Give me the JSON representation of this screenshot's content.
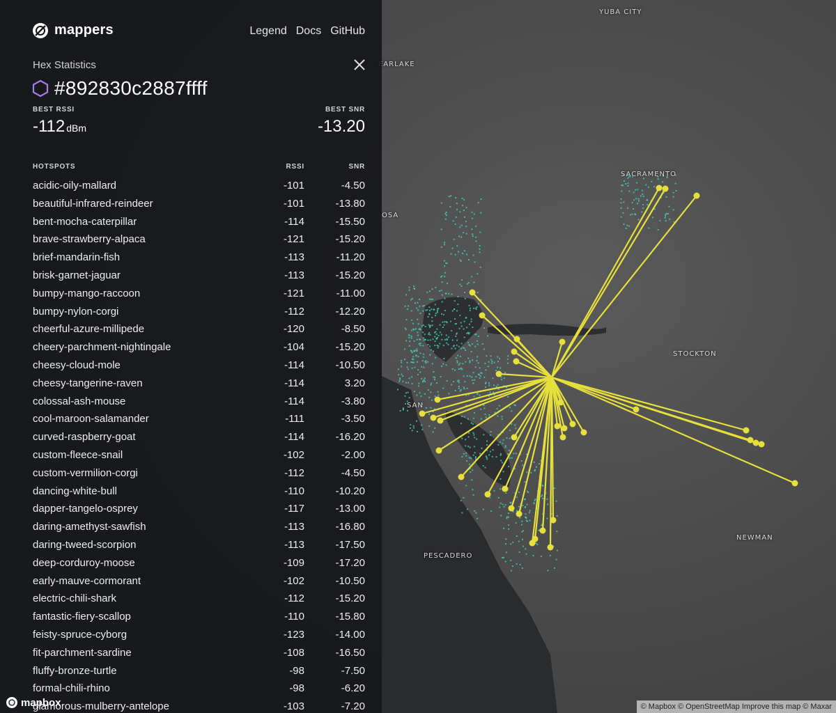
{
  "header": {
    "brand": "mappers",
    "nav": [
      "Legend",
      "Docs",
      "GitHub"
    ]
  },
  "panel": {
    "section_title": "Hex Statistics",
    "hex_id": "#892830c2887ffff",
    "best_rssi_label": "BEST RSSI",
    "best_rssi_value": "-112",
    "best_rssi_unit": "dBm",
    "best_snr_label": "BEST SNR",
    "best_snr_value": "-13.20",
    "table_headers": {
      "name": "HOTSPOTS",
      "rssi": "RSSI",
      "snr": "SNR"
    },
    "hotspots": [
      {
        "name": "acidic-oily-mallard",
        "rssi": "-101",
        "snr": "-4.50"
      },
      {
        "name": "beautiful-infrared-reindeer",
        "rssi": "-101",
        "snr": "-13.80"
      },
      {
        "name": "bent-mocha-caterpillar",
        "rssi": "-114",
        "snr": "-15.50"
      },
      {
        "name": "brave-strawberry-alpaca",
        "rssi": "-121",
        "snr": "-15.20"
      },
      {
        "name": "brief-mandarin-fish",
        "rssi": "-113",
        "snr": "-11.20"
      },
      {
        "name": "brisk-garnet-jaguar",
        "rssi": "-113",
        "snr": "-15.20"
      },
      {
        "name": "bumpy-mango-raccoon",
        "rssi": "-121",
        "snr": "-11.00"
      },
      {
        "name": "bumpy-nylon-corgi",
        "rssi": "-112",
        "snr": "-12.20"
      },
      {
        "name": "cheerful-azure-millipede",
        "rssi": "-120",
        "snr": "-8.50"
      },
      {
        "name": "cheery-parchment-nightingale",
        "rssi": "-104",
        "snr": "-15.20"
      },
      {
        "name": "cheesy-cloud-mole",
        "rssi": "-114",
        "snr": "-10.50"
      },
      {
        "name": "cheesy-tangerine-raven",
        "rssi": "-114",
        "snr": "3.20"
      },
      {
        "name": "colossal-ash-mouse",
        "rssi": "-114",
        "snr": "-3.80"
      },
      {
        "name": "cool-maroon-salamander",
        "rssi": "-111",
        "snr": "-3.50"
      },
      {
        "name": "curved-raspberry-goat",
        "rssi": "-114",
        "snr": "-16.20"
      },
      {
        "name": "custom-fleece-snail",
        "rssi": "-102",
        "snr": "-2.00"
      },
      {
        "name": "custom-vermilion-corgi",
        "rssi": "-112",
        "snr": "-4.50"
      },
      {
        "name": "dancing-white-bull",
        "rssi": "-110",
        "snr": "-10.20"
      },
      {
        "name": "dapper-tangelo-osprey",
        "rssi": "-117",
        "snr": "-13.00"
      },
      {
        "name": "daring-amethyst-sawfish",
        "rssi": "-113",
        "snr": "-16.80"
      },
      {
        "name": "daring-tweed-scorpion",
        "rssi": "-113",
        "snr": "-17.50"
      },
      {
        "name": "deep-corduroy-moose",
        "rssi": "-109",
        "snr": "-17.20"
      },
      {
        "name": "early-mauve-cormorant",
        "rssi": "-102",
        "snr": "-10.50"
      },
      {
        "name": "electric-chili-shark",
        "rssi": "-112",
        "snr": "-15.20"
      },
      {
        "name": "fantastic-fiery-scallop",
        "rssi": "-110",
        "snr": "-15.80"
      },
      {
        "name": "feisty-spruce-cyborg",
        "rssi": "-123",
        "snr": "-14.00"
      },
      {
        "name": "fit-parchment-sardine",
        "rssi": "-108",
        "snr": "-16.50"
      },
      {
        "name": "fluffy-bronze-turtle",
        "rssi": "-98",
        "snr": "-7.50"
      },
      {
        "name": "formal-chili-rhino",
        "rssi": "-98",
        "snr": "-6.20"
      },
      {
        "name": "glamorous-mulberry-antelope",
        "rssi": "-103",
        "snr": "-7.20"
      }
    ]
  },
  "map": {
    "place_labels": [
      {
        "text": "YUBA CITY"
      },
      {
        "text": "EARLAKE"
      },
      {
        "text": "SACRAMENTO"
      },
      {
        "text": "OSA"
      },
      {
        "text": "STOCKTON"
      },
      {
        "text": "SAN"
      },
      {
        "text": "PESCADERO"
      },
      {
        "text": "NEWMAN"
      }
    ],
    "colors": {
      "link": "#e6df3c",
      "coverage": "#3fd9c3",
      "hex": "#a67ce8"
    }
  },
  "footer": {
    "mapbox_logo": "mapbox",
    "attribution": "© Mapbox © OpenStreetMap Improve this map © Maxar"
  }
}
